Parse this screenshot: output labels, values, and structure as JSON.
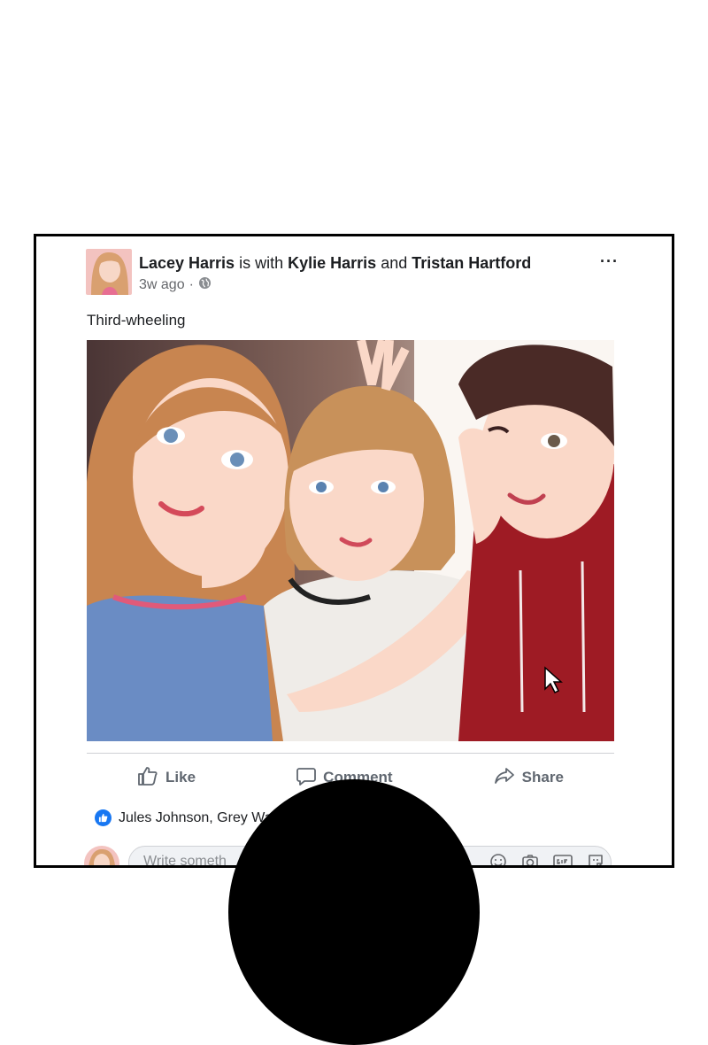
{
  "post": {
    "author": "Lacey Harris",
    "with_text": "is with",
    "tagged_1": "Kylie Harris",
    "and_text": "and",
    "tagged_2": "Tristan Hartford",
    "time": "3w ago",
    "separator": "·",
    "caption": "Third-wheeling",
    "more": "···"
  },
  "actions": {
    "like": "Like",
    "comment": "Comment",
    "share": "Share"
  },
  "reactions": {
    "names": "Jules Johnson, Grey Wa"
  },
  "comment_input": {
    "placeholder": "Write someth"
  },
  "colors": {
    "accent": "#1877f2",
    "hoodie": "#9e1b24",
    "frame": "#000000"
  },
  "icons": [
    "globe-icon",
    "more-icon",
    "thumbs-up-icon",
    "comment-icon",
    "share-icon",
    "like-badge-icon",
    "emoji-icon",
    "camera-icon",
    "gif-icon",
    "sticker-icon",
    "cursor-icon"
  ]
}
